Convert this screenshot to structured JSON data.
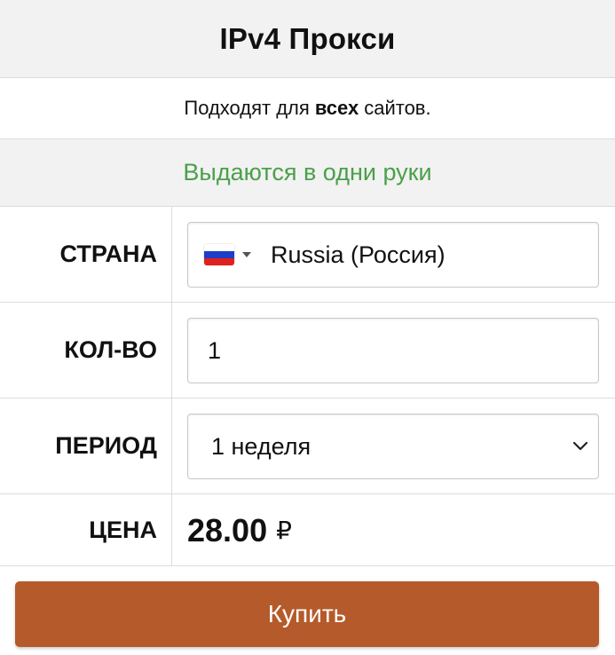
{
  "header": {
    "title": "IPv4 Прокси"
  },
  "subtitle": {
    "before": "Подходят для",
    "bold": "всех",
    "after": "сайтов."
  },
  "notice": {
    "text": "Выдаются в одни руки",
    "color": "#4aa04a"
  },
  "form": {
    "country": {
      "label": "СТРАНА",
      "value": "Russia (Россия)",
      "flag_icon": "russia-flag-icon"
    },
    "quantity": {
      "label": "КОЛ-ВО",
      "value": "1"
    },
    "period": {
      "label": "ПЕРИОД",
      "value": "1 неделя"
    },
    "price": {
      "label": "ЦЕНА",
      "value": "28.00",
      "currency": "₽"
    }
  },
  "buy_button": {
    "label": "Купить",
    "color": "#b55a2b"
  }
}
